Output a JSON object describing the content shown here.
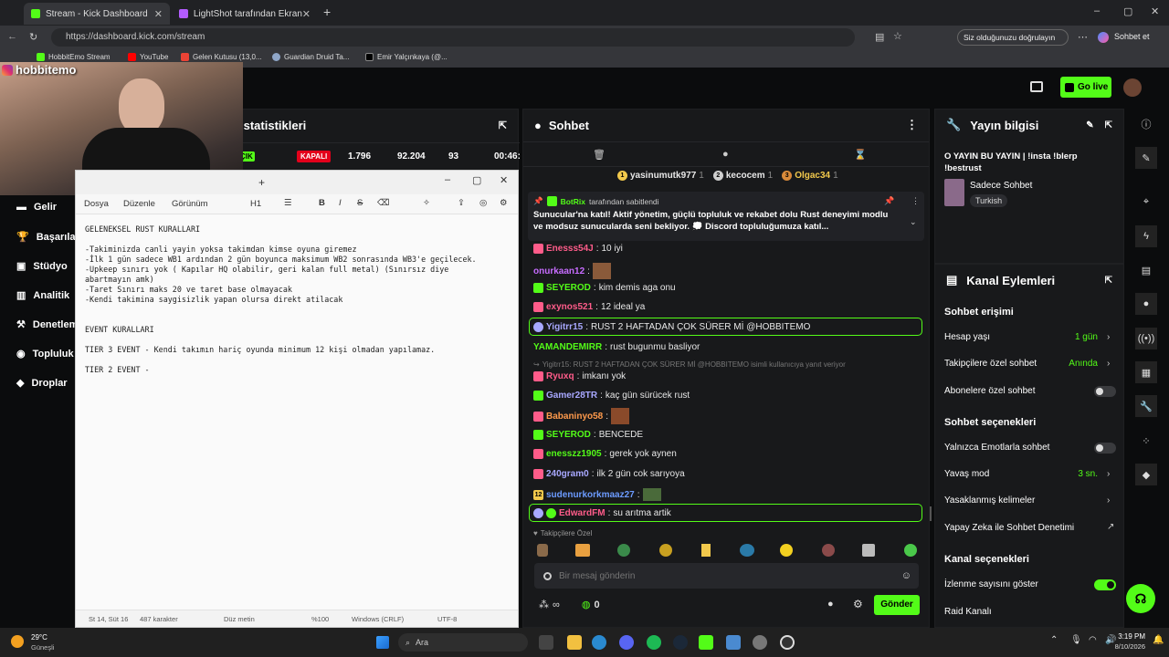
{
  "browser": {
    "tabs": [
      {
        "title": "Stream - Kick Dashboard",
        "active": true
      },
      {
        "title": "LightShot tarafından Ekran Görüntü",
        "active": false
      }
    ],
    "url": "https://dashboard.kick.com/stream",
    "signed_in_text": "Siz olduğunuzu doğrulayın",
    "chat_label": "Sohbet et",
    "bookmarks": [
      "HobbitEmo Stream",
      "YouTube",
      "Gelen Kutusu (13,0...",
      "Guardian Druid Ta...",
      "Emir Yalçınkaya (@..."
    ]
  },
  "webcam": {
    "username": "hobbitemo"
  },
  "header": {
    "go_live": "Go live"
  },
  "sidenav": {
    "items": [
      "Gelir",
      "Başarılar",
      "Stüdyo",
      "Analitik",
      "Denetleme",
      "Topluluk",
      "Droplar"
    ]
  },
  "stats": {
    "title": "İstatistikleri",
    "live_badge": "ÇIK",
    "status": "KAPALI",
    "values": [
      "1.796",
      "92.204",
      "93",
      "00:46:"
    ]
  },
  "chat": {
    "title": "Sohbet",
    "top_gifters": [
      {
        "name": "yasinumutk977",
        "count": "1",
        "color": "#f2c94c"
      },
      {
        "name": "kecocem",
        "count": "1",
        "color": "#cfcfcf"
      },
      {
        "name": "Olgac34",
        "count": "1",
        "color": "#d98a3a"
      }
    ],
    "pinned": {
      "author": "BotRix",
      "label": "tarafından sabitlendi",
      "text": "Sunucular'na katıl! Aktif yönetim, güçlü topluluk ve rekabet dolu Rust deneyimi modlu ve modsuz sunucularda seni bekliyor. 💭 Discord topluluğumuza katıl..."
    },
    "messages": [
      {
        "user": "Enesss54J",
        "text": "10 iyi",
        "color": "#ff5c8a"
      },
      {
        "user": "onurkaan12",
        "text": "",
        "color": "#c76cff"
      },
      {
        "user": "SEYEROD",
        "text": "kim demis aga onu",
        "color": "#53fc18"
      },
      {
        "user": "exynos521",
        "text": "12 ideal ya",
        "color": "#ff5c8a"
      },
      {
        "user": "Yigitrr15",
        "text": "RUST 2 HAFTADAN ÇOK SÜRER Mİ @HOBBITEMO",
        "color": "#a8a8ff",
        "highlight": true
      },
      {
        "user": "YAMANDEMIRR",
        "text": "rust bugunmu basliyor",
        "color": "#53fc18"
      },
      {
        "reply": "Yigitrr15: RUST 2 HAFTADAN ÇOK SÜRER Mİ @HOBBITEMO isimli kullanıcıya yanıt veriyor"
      },
      {
        "user": "Ryuxq",
        "text": "imkanı yok",
        "color": "#ff5c8a"
      },
      {
        "user": "Gamer28TR",
        "text": "kaç gün sürücek rust",
        "color": "#a8a8ff"
      },
      {
        "user": "Babaninyo58",
        "text": "",
        "color": "#ff9a4c"
      },
      {
        "user": "SEYEROD",
        "text": "BENCEDE",
        "color": "#53fc18"
      },
      {
        "user": "enesszz1905",
        "text": "gerek yok aynen",
        "color": "#53fc18"
      },
      {
        "user": "240gram0",
        "text": "ilk 2 gün cok sarıyoya",
        "color": "#a8a8ff"
      },
      {
        "user": "sudenurkorkmaaz27",
        "text": "",
        "color": "#6c9bff"
      },
      {
        "user": "EdwardFM",
        "text": "su arıtma artik",
        "color": "#ff5c8a",
        "highlight": true
      }
    ],
    "followers_label": "Takipçilere Özel",
    "input_placeholder": "Bir mesaj gönderin",
    "points": "0",
    "send": "Gönder"
  },
  "stream_info": {
    "title": "Yayın bilgisi",
    "stream_title": "O YAYIN BU YAYIN | !insta !blerp !bestrust",
    "category": "Sadece Sohbet",
    "language": "Turkish"
  },
  "channel_actions": {
    "title": "Kanal Eylemleri",
    "chat_access": "Sohbet erişimi",
    "rows": [
      {
        "label": "Hesap yaşı",
        "value": "1 gün"
      },
      {
        "label": "Takipçilere özel sohbet",
        "value": "Anında"
      },
      {
        "label": "Abonelere özel sohbet",
        "value": ""
      }
    ],
    "chat_options": "Sohbet seçenekleri",
    "options": [
      {
        "label": "Yalnızca Emotlarla sohbet",
        "value": ""
      },
      {
        "label": "Yavaş mod",
        "value": "3 sn."
      },
      {
        "label": "Yasaklanmış kelimeler",
        "value": ""
      },
      {
        "label": "Yapay Zeka ile Sohbet Denetimi",
        "value": ""
      }
    ],
    "channel_options": "Kanal seçenekleri",
    "channel_rows": [
      "İzlenme sayısını göster",
      "Raid Kanalı"
    ]
  },
  "notepad": {
    "menu": [
      "Dosya",
      "Düzenle",
      "Görünüm"
    ],
    "heading": "H1",
    "text": "GELENEKSEL RUST KURALLARI\n\n-Takiminizda canli yayin yoksa takimdan kimse oyuna giremez\n-İlk 1 gün sadece WB1 ardından 2 gün boyunca maksimum WB2 sonrasında WB3'e geçilecek.\n-Upkeep sınırı yok ( Kapılar HQ olabilir, geri kalan full metal) (Sınırsız diye\nabartmayın amk)\n-Taret Sınırı maks 20 ve taret base olmayacak\n-Kendi takimina saygisizlik yapan olursa direkt atilacak\n\n\nEVENT KURALLARI\n\nTIER 3 EVENT - Kendi takımın hariç oyunda minimum 12 kişi olmadan yapılamaz.\n\nTIER 2 EVENT -",
    "status": [
      "St 14, Süt 16",
      "487 karakter",
      "Düz metin",
      "%100",
      "Windows (CRLF)",
      "UTF-8"
    ]
  },
  "taskbar": {
    "temp": "29°C",
    "weather": "Güneşli",
    "search": "Ara",
    "time": "3:19 PM",
    "date": "8/10/2026"
  },
  "colors": {
    "kick_green": "#53fc18",
    "bg": "#0b0c0d",
    "panel": "#18191b",
    "live_red": "#e3001b"
  }
}
